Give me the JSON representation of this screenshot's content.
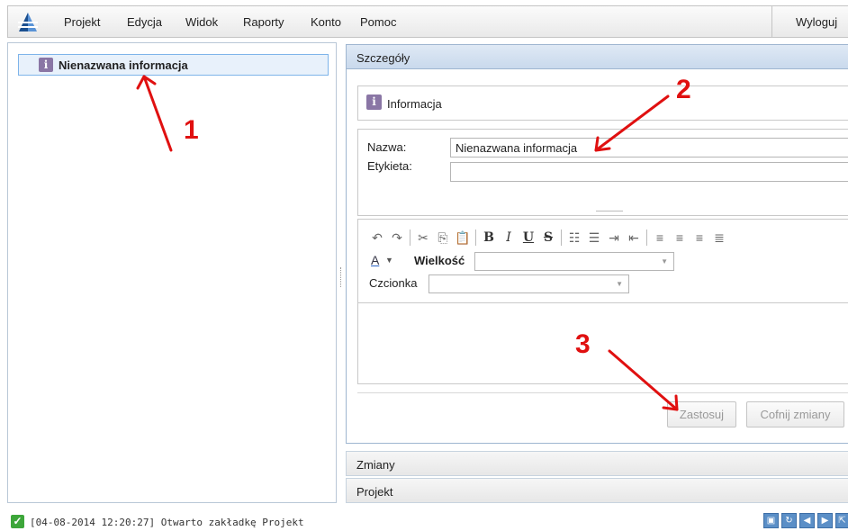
{
  "menubar": {
    "items": [
      "Projekt",
      "Edycja",
      "Widok",
      "Raporty",
      "Konto",
      "Pomoc"
    ],
    "logout_label": "Wyloguj"
  },
  "tree": {
    "selected_item": {
      "icon": "info-icon",
      "glyph": "i",
      "label": "Nienazwana informacja"
    }
  },
  "accordion": {
    "details": {
      "header": "Szczegóły",
      "info_glyph": "i",
      "info_title": "Informacja",
      "name_label": "Nazwa:",
      "name_value": "Nienazwana informacja",
      "tag_label": "Etykieta:",
      "tag_value": "",
      "size_label": "Wielkość",
      "size_value": "",
      "font_label": "Czcionka",
      "font_value": "",
      "apply_label": "Zastosuj",
      "revert_label": "Cofnij zmiany"
    },
    "changes_header": "Zmiany",
    "project_header": "Projekt"
  },
  "status": {
    "message": "[04-08-2014 12:20:27] Otwarto zakładkę Projekt"
  },
  "annotations": [
    "1",
    "2",
    "3"
  ],
  "colors": {
    "accent_blue": "#7eb4ea",
    "annotation_red": "#e01010",
    "info_badge": "#8a76a5",
    "status_ok": "#3da63a"
  }
}
